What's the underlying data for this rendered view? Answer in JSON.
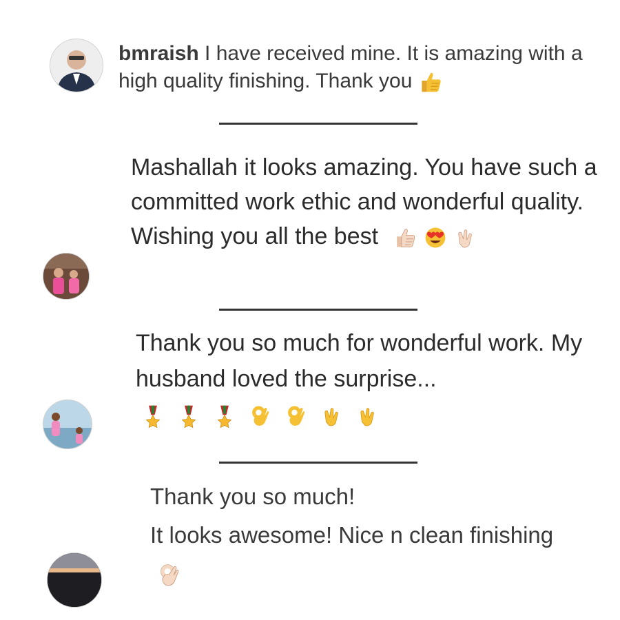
{
  "comments": [
    {
      "username": "bmraish",
      "text": " I have received mine. It is amazing with a high quality finishing. Thank you",
      "emojis": [
        "thumbs-up-icon"
      ]
    },
    {
      "text": "Mashallah it looks amazing. You have such a committed work ethic and wonderful quality. Wishing you all the best",
      "emojis": [
        "thumbs-up-light-icon",
        "heart-eyes-icon",
        "clapping-light-icon"
      ]
    },
    {
      "text": "Thank you so much for wonderful work. My husband loved the surprise...",
      "emojis": [
        "medal-icon",
        "medal-icon",
        "medal-icon",
        "ok-hand-icon",
        "ok-hand-icon",
        "clapping-icon",
        "clapping-icon"
      ]
    },
    {
      "line1": "Thank you so much!",
      "line2": "It looks awesome! Nice n clean finishing",
      "emojis": [
        "ok-hand-light-icon"
      ]
    }
  ],
  "colors": {
    "text": "#2b2b2b",
    "divider": "#333333",
    "emoji_yellow": "#f5c033",
    "emoji_light": "#f6d9c4"
  }
}
